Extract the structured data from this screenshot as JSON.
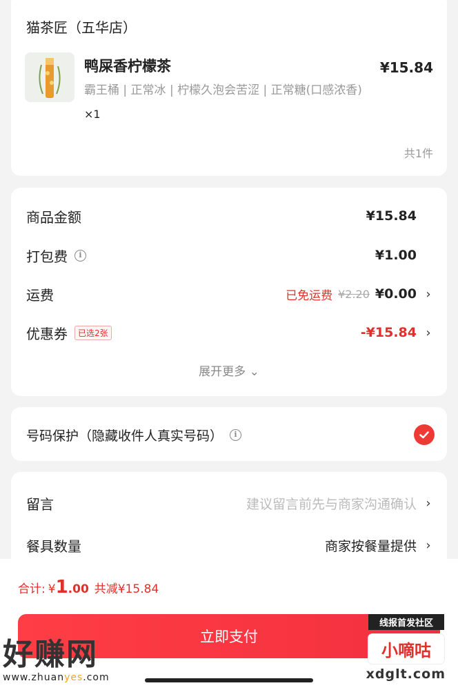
{
  "shop": {
    "name": "猫茶匠（五华店）",
    "product": {
      "name": "鸭屎香柠檬茶",
      "price": "¥15.84",
      "specs": "霸王桶 | 正常冰 | 柠檬久泡会苦涩 | 正常糖(口感浓香)",
      "quantity": "×1"
    },
    "total_count": "共1件"
  },
  "amounts": {
    "goods_label": "商品金额",
    "goods_value": "¥15.84",
    "packing_label": "打包费",
    "packing_value": "¥1.00",
    "shipping_label": "运费",
    "shipping_free": "已免运费",
    "shipping_original": "¥2.20",
    "shipping_value": "¥0.00",
    "coupon_label": "优惠券",
    "coupon_badge": "已选2张",
    "coupon_value": "-¥15.84",
    "expand_more": "展开更多 ⌄"
  },
  "privacy": {
    "label": "号码保护（隐藏收件人真实号码）",
    "checked": true
  },
  "note": {
    "label": "留言",
    "hint": "建议留言前先与商家沟通确认",
    "utensils_label": "餐具数量",
    "utensils_value": "商家按餐量提供"
  },
  "footer": {
    "total_label": "合计:",
    "currency": "¥",
    "total_int": "1",
    "total_dec": ".00",
    "saved": "共减¥15.84",
    "pay_button": "立即支付"
  },
  "watermark": {
    "left_big": "好赚网",
    "left_url_a": "www.zhuan",
    "left_url_b": "yes",
    "left_url_c": ".com",
    "right_tag": "线报首发社区",
    "right_box": "小嘀咕",
    "right_url": "xdglt.com"
  },
  "colors": {
    "accent": "#e0302c",
    "pay_button": "#f3303e",
    "background": "#f3f3f3"
  }
}
